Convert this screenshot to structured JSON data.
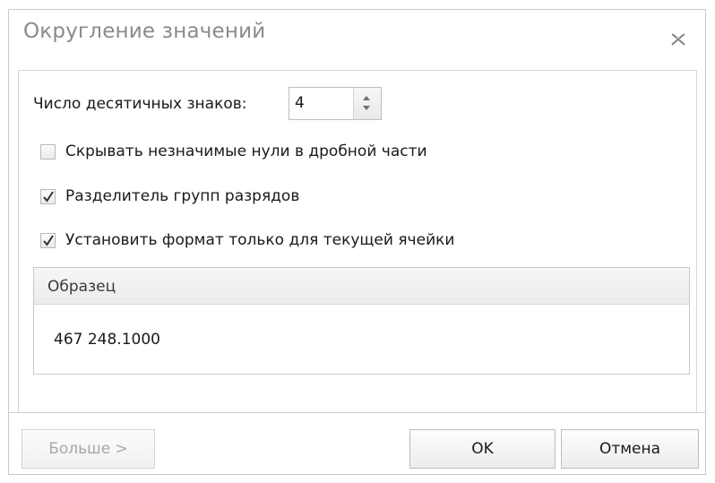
{
  "dialog": {
    "title": "Округление значений",
    "close_icon": "close-icon"
  },
  "decimal_places": {
    "label": "Число десятичных знаков:",
    "value": "4"
  },
  "options": [
    {
      "label": "Скрывать незначимые нули в дробной части",
      "checked": false
    },
    {
      "label": "Разделитель групп разрядов",
      "checked": true
    },
    {
      "label": "Установить формат только для текущей ячейки",
      "checked": true
    }
  ],
  "sample": {
    "title": "Образец",
    "value": "467 248.1000"
  },
  "buttons": {
    "more": "Больше >",
    "ok": "OK",
    "cancel": "Отмена"
  }
}
